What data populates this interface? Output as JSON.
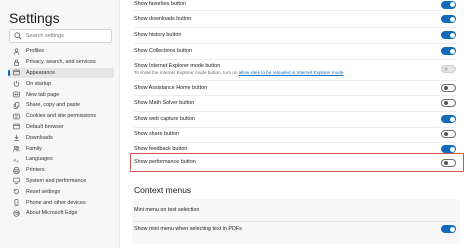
{
  "sidebar": {
    "title": "Settings",
    "search_placeholder": "Search settings",
    "items": [
      {
        "label": "Profiles",
        "icon": "person-icon"
      },
      {
        "label": "Privacy, search, and services",
        "icon": "lock-icon"
      },
      {
        "label": "Appearance",
        "icon": "appearance-icon",
        "active": true
      },
      {
        "label": "On startup",
        "icon": "power-icon"
      },
      {
        "label": "New tab page",
        "icon": "new-tab-icon"
      },
      {
        "label": "Share, copy and paste",
        "icon": "share-icon"
      },
      {
        "label": "Cookies and site permissions",
        "icon": "cookie-icon"
      },
      {
        "label": "Default browser",
        "icon": "browser-icon"
      },
      {
        "label": "Downloads",
        "icon": "download-icon"
      },
      {
        "label": "Family",
        "icon": "family-icon"
      },
      {
        "label": "Languages",
        "icon": "languages-icon"
      },
      {
        "label": "Printers",
        "icon": "printer-icon"
      },
      {
        "label": "System and performance",
        "icon": "system-icon"
      },
      {
        "label": "Reset settings",
        "icon": "reset-icon"
      },
      {
        "label": "Phone and other devices",
        "icon": "phone-icon"
      },
      {
        "label": "About Microsoft Edge",
        "icon": "edge-icon"
      }
    ]
  },
  "main": {
    "rows": [
      {
        "label": "Show favorites button",
        "state": "on"
      },
      {
        "label": "Show downloads button",
        "state": "on"
      },
      {
        "label": "Show history button",
        "state": "on"
      },
      {
        "label": "Show Collections button",
        "state": "on"
      },
      {
        "label": "Show Internet Explorer mode button",
        "state": "disabled",
        "sub_text": "To show the Internet Explorer mode button, turn on",
        "sub_link": "allow sites to be reloaded in Internet Explorer mode"
      },
      {
        "label": "Show Assistance Home button",
        "state": "off"
      },
      {
        "label": "Show Math Solver button",
        "state": "off"
      },
      {
        "label": "Show web capture button",
        "state": "on"
      },
      {
        "label": "Show share button",
        "state": "off"
      },
      {
        "label": "Show feedback button",
        "state": "on"
      },
      {
        "label": "Show performance button",
        "state": "off"
      }
    ],
    "section_title": "Context menus",
    "context_rows": [
      {
        "label": "Mini menu on text selection"
      },
      {
        "label": "Show mini menu when selecting text in PDFs",
        "state": "on"
      }
    ]
  },
  "colors": {
    "accent": "#0f6cbd",
    "highlight": "#d9534f"
  }
}
